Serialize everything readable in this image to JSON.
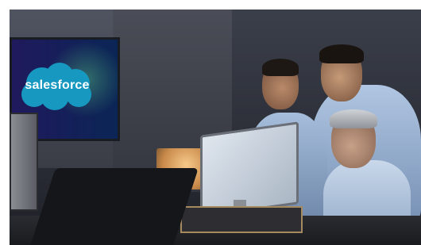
{
  "logo": {
    "text": "salesforce",
    "color": "#1798c1"
  },
  "colors": {
    "background": "#ffffff",
    "scene_dark": "#2c2f38"
  }
}
